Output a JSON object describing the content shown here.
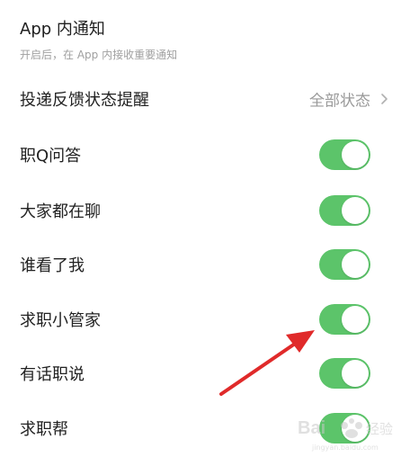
{
  "section": {
    "title": "App 内通知",
    "description": "开启后，在 App 内接收重要通知"
  },
  "delivery_feedback": {
    "label": "投递反馈状态提醒",
    "value": "全部状态"
  },
  "toggles": [
    {
      "label": "职Q问答",
      "on": true
    },
    {
      "label": "大家都在聊",
      "on": true
    },
    {
      "label": "谁看了我",
      "on": true
    },
    {
      "label": "求职小管家",
      "on": true
    },
    {
      "label": "有话职说",
      "on": true
    },
    {
      "label": "求职帮",
      "on": true
    }
  ],
  "colors": {
    "toggle_on": "#5cc46a",
    "annotation_arrow": "#e02a2a"
  },
  "icons": {
    "chevron": "chevron-right-icon",
    "annotation": "red-arrow-annotation"
  }
}
